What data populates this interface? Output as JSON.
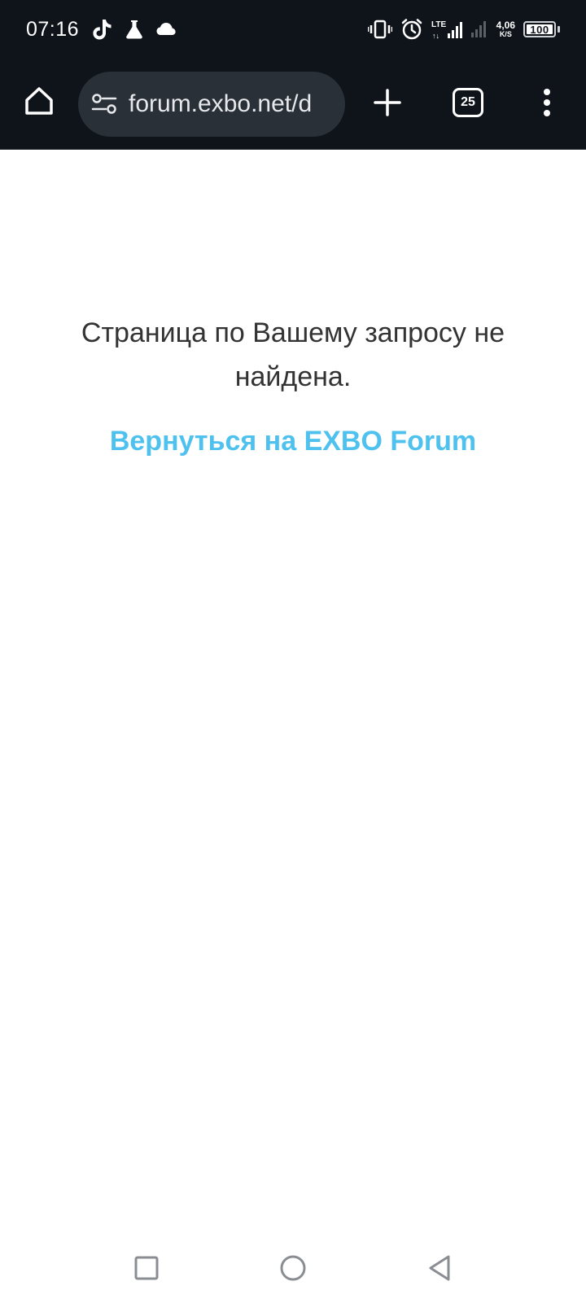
{
  "status_bar": {
    "time": "07:16",
    "network_type": "LTE",
    "speed_value": "4,06",
    "speed_unit": "K/S",
    "battery_level": "100",
    "battery_fraction": 1.0,
    "left_icons": [
      "tiktok-icon",
      "flask-icon",
      "cloud-icon"
    ],
    "right_icons": [
      "vibrate-icon",
      "alarm-icon",
      "lte-signal-icon",
      "signal-icon",
      "battery-icon"
    ]
  },
  "toolbar": {
    "url": "forum.exbo.net/d",
    "tab_count": "25",
    "icons": [
      "home-icon",
      "tune-icon",
      "plus-icon",
      "tab-switcher-icon",
      "more-vert-icon"
    ]
  },
  "page": {
    "message": "Страница по Вашему запросу не найдена.",
    "back_link": "Вернуться на EXBO Forum",
    "link_color": "#4fc1ef",
    "text_color": "#333333"
  },
  "nav_bar": {
    "icons": [
      "recents-square-icon",
      "home-circle-icon",
      "back-triangle-icon"
    ]
  },
  "colors": {
    "chrome_bg": "#0f141b",
    "address_bar_bg": "#2a3038"
  }
}
